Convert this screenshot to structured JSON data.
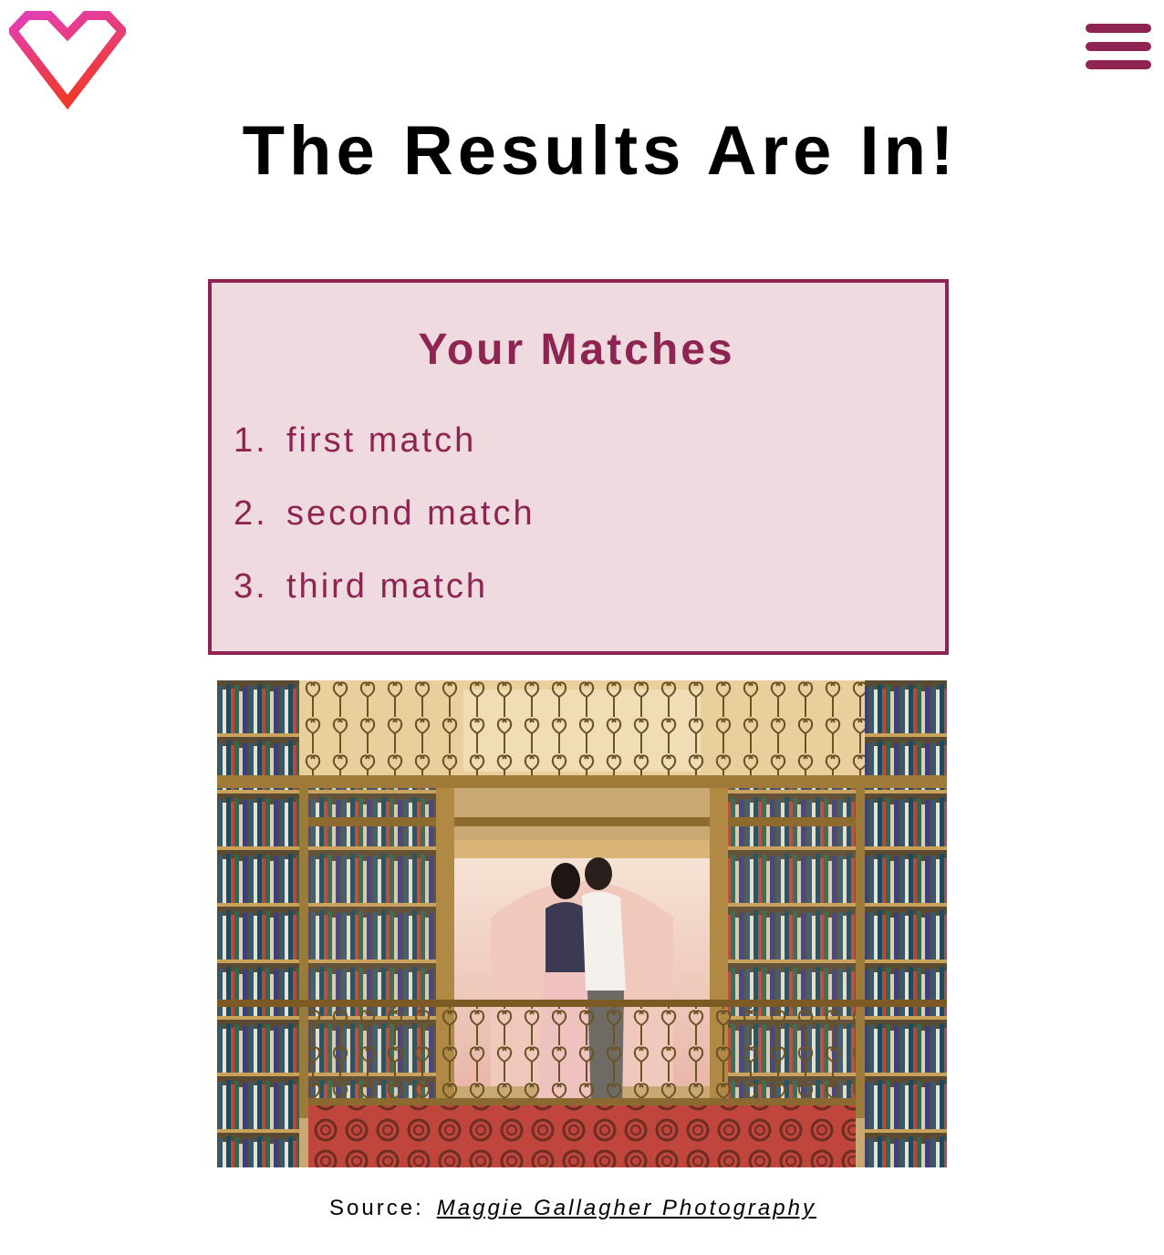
{
  "header": {
    "logo_icon": "heart-logo-icon",
    "menu_icon": "hamburger-menu-icon"
  },
  "page": {
    "title": "The Results Are In!"
  },
  "matches": {
    "heading": "Your Matches",
    "items": [
      {
        "number": "1.",
        "label": "first match"
      },
      {
        "number": "2.",
        "label": "second match"
      },
      {
        "number": "3.",
        "label": "third match"
      }
    ]
  },
  "photo": {
    "subject": "couple-kissing-in-library-photo"
  },
  "credit": {
    "prefix": "Source:",
    "link_text": "Maggie Gallagher Photography"
  },
  "colors": {
    "accent": "#8d2452",
    "box_background": "#efdbdf",
    "logo_gradient_top": "#e23fb8",
    "logo_gradient_bottom": "#f0392b"
  }
}
